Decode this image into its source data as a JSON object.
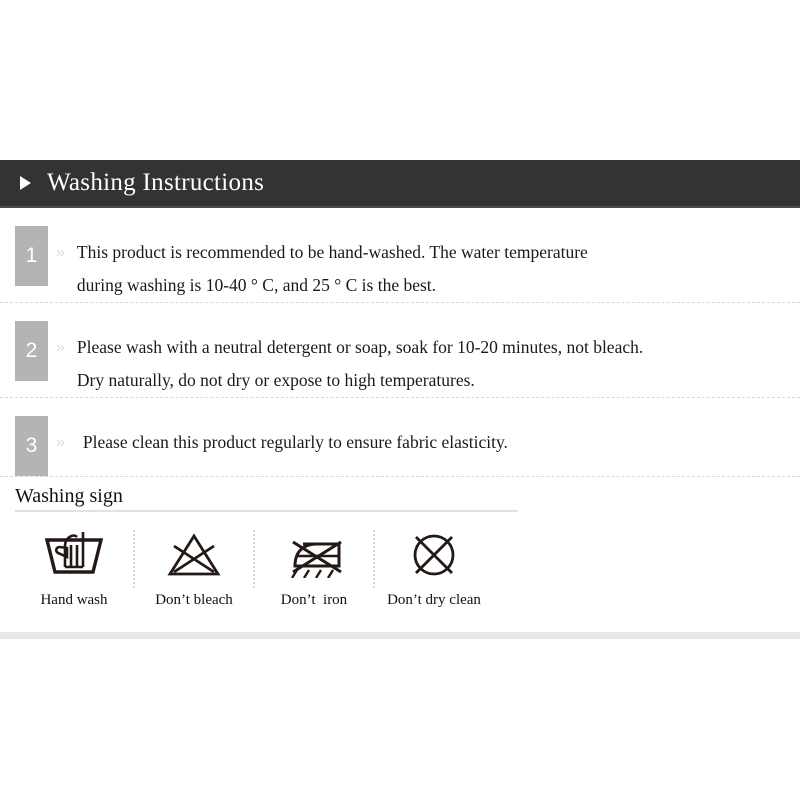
{
  "header": {
    "arrow_icon": "triangle-right-icon",
    "title": "Washing Instructions"
  },
  "instructions": [
    {
      "number": "1",
      "chevron": "»",
      "lines": [
        "This product is recommended to be hand-washed. The water temperature",
        "during washing is 10-40 ° C, and 25 ° C is the best."
      ]
    },
    {
      "number": "2",
      "chevron": "»",
      "lines": [
        "Please wash with a neutral detergent or soap, soak for 10-20 minutes, not bleach.",
        "Dry naturally, do not dry or expose to high temperatures."
      ]
    },
    {
      "number": "3",
      "chevron": "»",
      "lines": [
        "Please clean this product regularly to ensure fabric elasticity."
      ]
    }
  ],
  "washing_sign": {
    "title": "Washing sign",
    "symbols": [
      {
        "icon": "hand-wash-icon",
        "label": "Hand wash"
      },
      {
        "icon": "do-not-bleach-icon",
        "label": "Don’t bleach"
      },
      {
        "icon": "do-not-iron-icon",
        "label": "Don’t  iron"
      },
      {
        "icon": "do-not-dry-clean-icon",
        "label": "Don’t dry clean"
      }
    ]
  },
  "colors": {
    "header_bg": "#333333",
    "badge_bg": "#b4b4b4",
    "text": "#1a1a1a",
    "separator": "#d8d8d8",
    "band": "#e8e8e8"
  }
}
